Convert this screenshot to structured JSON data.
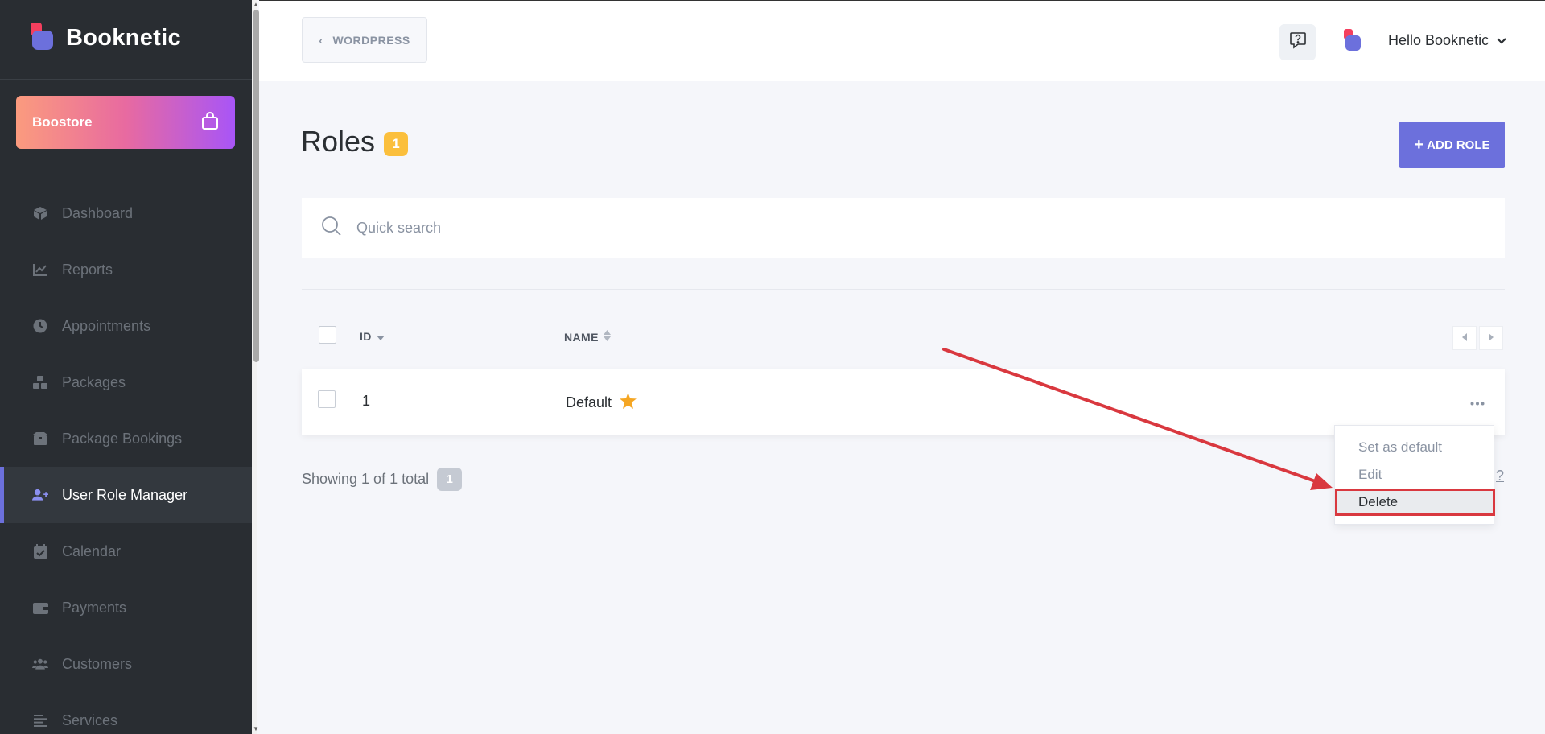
{
  "brand": {
    "name": "Booknetic"
  },
  "boostore": {
    "label": "Boostore"
  },
  "nav": {
    "items": [
      {
        "label": "Dashboard",
        "icon": "box-icon"
      },
      {
        "label": "Reports",
        "icon": "chart-icon"
      },
      {
        "label": "Appointments",
        "icon": "clock-icon"
      },
      {
        "label": "Packages",
        "icon": "boxes-icon"
      },
      {
        "label": "Package Bookings",
        "icon": "gift-box-icon"
      },
      {
        "label": "User Role Manager",
        "icon": "user-plus-icon",
        "active": true
      },
      {
        "label": "Calendar",
        "icon": "calendar-icon"
      },
      {
        "label": "Payments",
        "icon": "wallet-icon"
      },
      {
        "label": "Customers",
        "icon": "users-icon"
      },
      {
        "label": "Services",
        "icon": "list-icon"
      }
    ]
  },
  "topbar": {
    "wordpress_label": "WORDPRESS",
    "greeting": "Hello Booknetic"
  },
  "main": {
    "title": "Roles",
    "count": "1",
    "add_button": "ADD ROLE",
    "search_placeholder": "Quick search",
    "columns": {
      "id": "ID",
      "name": "NAME"
    },
    "rows": [
      {
        "id": "1",
        "name": "Default",
        "is_default": true
      }
    ],
    "row_menu": {
      "set_default": "Set as default",
      "edit": "Edit",
      "delete": "Delete"
    },
    "showing_text": "Showing 1 of 1 total",
    "showing_count": "1",
    "help_link": "?"
  },
  "colors": {
    "sidebar_bg": "#292d32",
    "accent": "#6c70dc",
    "badge": "#fbbf3c",
    "annotation": "#d9383f"
  }
}
